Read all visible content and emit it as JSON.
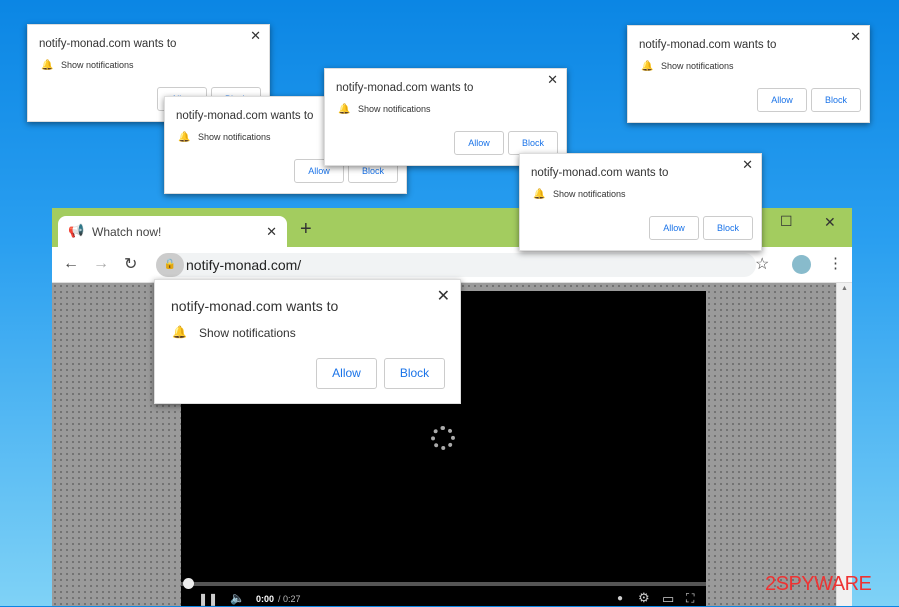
{
  "browser": {
    "tab_title": "Whatch now!",
    "new_tab": "+",
    "url": "notify-monad.com/",
    "window_controls": {
      "maximize": "☐",
      "close": "✕"
    }
  },
  "video": {
    "time_current": "0:00",
    "time_total": "/ 0:27"
  },
  "popups": [
    {
      "title": "notify-monad.com wants to",
      "message": "Show notifications",
      "allow": "Allow",
      "block": "Block",
      "close": "✕"
    },
    {
      "title": "notify-monad.com wants to",
      "message": "Show notifications",
      "allow": "Allow",
      "block": "Block",
      "close": "✕"
    },
    {
      "title": "notify-monad.com wants to",
      "message": "Show notifications",
      "allow": "Allow",
      "block": "Block",
      "close": "✕"
    },
    {
      "title": "notify-monad.com wants to",
      "message": "Show notifications",
      "allow": "Allow",
      "block": "Block",
      "close": "✕"
    },
    {
      "title": "notify-monad.com wants to",
      "message": "Show notifications",
      "allow": "Allow",
      "block": "Block",
      "close": "✕"
    },
    {
      "title": "notify-monad.com wants to",
      "message": "Show notifications",
      "allow": "Allow",
      "block": "Block",
      "close": "✕"
    }
  ],
  "watermark": "2SPYWARE",
  "colors": {
    "tabbar": "#a3cc5f",
    "link": "#1a73e8",
    "background_top": "#0b86e4",
    "background_bottom": "#7fd2f6"
  }
}
